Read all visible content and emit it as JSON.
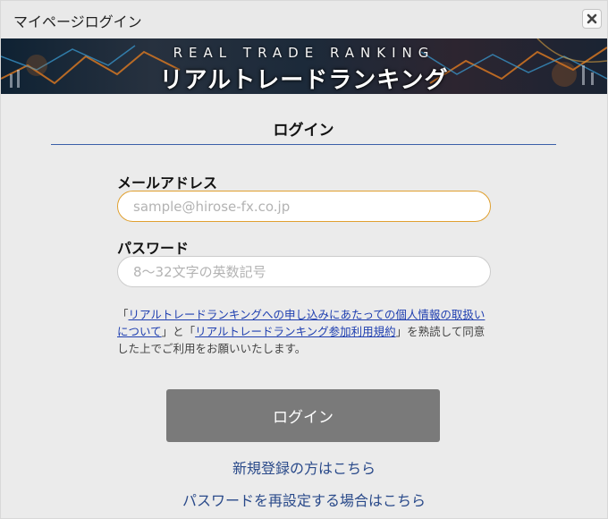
{
  "window": {
    "title": "マイページログイン",
    "close_icon": "close-x-icon"
  },
  "banner": {
    "title_en": "REAL TRADE RANKING",
    "title_jp": "リアルトレードランキング"
  },
  "login_form": {
    "heading": "ログイン",
    "email": {
      "label": "メールアドレス",
      "placeholder": "sample@hirose-fx.co.jp",
      "value": ""
    },
    "password": {
      "label": "パスワード",
      "placeholder": "8〜32文字の英数記号",
      "value": ""
    },
    "notice": {
      "open_quote_1": "「",
      "link_privacy": "リアルトレードランキングへの申し込みにあたっての個人情報の取扱いについて",
      "joiner": "」と「",
      "link_terms": "リアルトレードランキング参加利用規約",
      "closing": "」を熟読して同意した上でご利用をお願いいたします。"
    },
    "submit_label": "ログイン"
  },
  "links": {
    "register": "新規登録の方はこちら",
    "reset_password": "パスワードを再設定する場合はこちら"
  },
  "colors": {
    "accent_link": "#1f3fb0",
    "footer_link": "#2a4a8a",
    "rule": "#3a5fa8",
    "focus_border": "#e0a030",
    "button_bg": "#7a7a7a"
  }
}
